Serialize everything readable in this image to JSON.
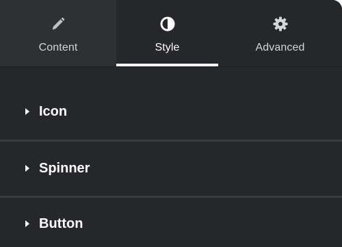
{
  "tabs": [
    {
      "label": "Content",
      "icon": "pencil-icon",
      "active": false
    },
    {
      "label": "Style",
      "icon": "contrast-icon",
      "active": true
    },
    {
      "label": "Advanced",
      "icon": "gear-icon",
      "active": false
    }
  ],
  "sections": [
    {
      "title": "Icon",
      "expanded": false
    },
    {
      "title": "Spinner",
      "expanded": false
    },
    {
      "title": "Button",
      "expanded": false
    }
  ],
  "colors": {
    "panel_bg": "#26272b",
    "inactive_tab_bg": "#2f3034",
    "active_indicator": "#ffffff",
    "text": "#ffffff",
    "muted_text": "#d4d5d8"
  }
}
